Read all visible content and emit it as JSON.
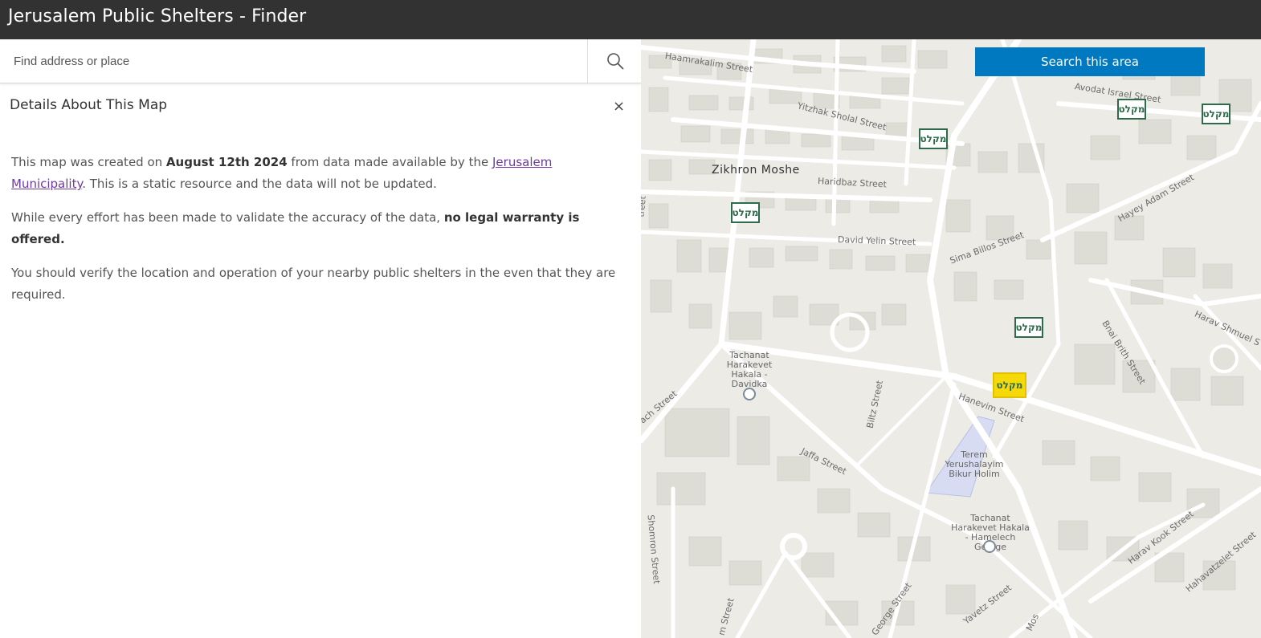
{
  "app": {
    "title": "Jerusalem Public Shelters - Finder"
  },
  "search": {
    "placeholder": "Find address or place",
    "icon": "search-icon"
  },
  "details": {
    "heading": "Details About This Map",
    "close_label": "×",
    "p1_a": "This map was created on ",
    "p1_date": "August 12th 2024",
    "p1_b": " from data made available by the ",
    "p1_link": "Jerusalem Municipality",
    "p1_c": ". This is a static resource and the data will not be updated.",
    "p2_a": "While every effort has been made to validate the accuracy of the data, ",
    "p2_bold": "no legal warranty is offered.",
    "p3": "You should verify the location and operation of your nearby public shelters in the even that they are required."
  },
  "map": {
    "search_area_label": "Search this area",
    "neighborhood": "Zikhron Moshe",
    "shelter_label": "מקלט",
    "streets": {
      "haamrakalim": "Haamrakalim Street",
      "yitzhak_sholal": "Yitzhak Sholal Street",
      "haridbaz": "Haridbaz Street",
      "david_yelin": "David Yelin Street",
      "sima_billos": "Sima Billos Street",
      "avodat_israel": "Avodat Israel Street",
      "hayey_adam": "Hayey Adam Street",
      "harav_shmuel": "Harav Shmuel S",
      "bnai_brith": "Bnai Brith Street",
      "hanevim": "Hanevim Street",
      "biltz": "Biltz Street",
      "jaffa": "Jaffa Street",
      "shomron": "Shomron Street",
      "harav_kook": "Harav Kook Street",
      "hahavatzelet": "Hahavatzelet Street",
      "yavetz": "Yavetz Street",
      "george": "George Street",
      "street_left": "treet",
      "ach_street": "ach Street",
      "m_street": "m Street",
      "mos": "Mos"
    },
    "places": {
      "davidka": "Tachanat Harakevet Hakala - Davidka",
      "bikur_holim": "Terem Yerushalayim Bikur Holim",
      "hamelech": "Tachanat Harakevet Hakala - Hamelech George"
    }
  },
  "colors": {
    "topbar": "#323232",
    "accent": "#0079c1",
    "shelter_border": "#2d6b4a",
    "selected_shelter": "#f5d90a"
  }
}
